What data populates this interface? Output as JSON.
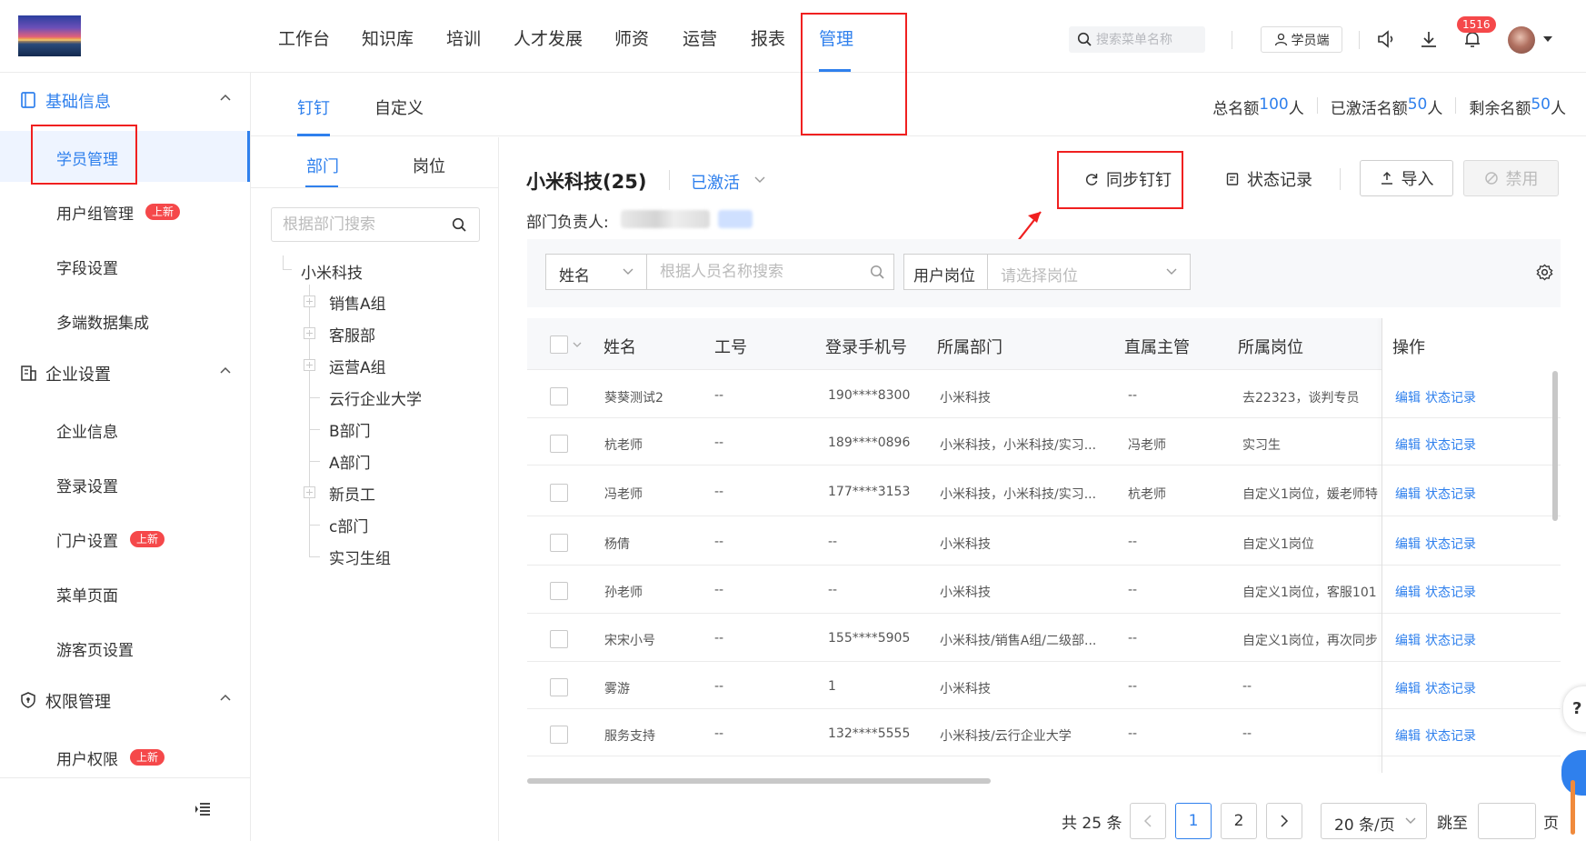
{
  "header": {
    "nav": [
      "工作台",
      "知识库",
      "培训",
      "人才发展",
      "师资",
      "运营",
      "报表",
      "管理"
    ],
    "active_nav": "管理",
    "search_placeholder": "搜索菜单名称",
    "student_btn": "学员端",
    "notification_count": "1516"
  },
  "sidebar": {
    "groups": [
      {
        "label": "基础信息",
        "icon": "book-icon",
        "items": [
          {
            "label": "学员管理",
            "active": true
          },
          {
            "label": "用户组管理",
            "badge": "上新"
          },
          {
            "label": "字段设置"
          },
          {
            "label": "多端数据集成"
          }
        ]
      },
      {
        "label": "企业设置",
        "icon": "building-icon",
        "items": [
          {
            "label": "企业信息"
          },
          {
            "label": "登录设置"
          },
          {
            "label": "门户设置",
            "badge": "上新"
          },
          {
            "label": "菜单页面"
          },
          {
            "label": "游客页设置"
          }
        ]
      },
      {
        "label": "权限管理",
        "icon": "shield-icon",
        "items": [
          {
            "label": "用户权限",
            "badge": "上新"
          }
        ]
      }
    ]
  },
  "tabs": [
    "钉钉",
    "自定义"
  ],
  "quota": {
    "total_label": "总名额",
    "total": "100",
    "total_unit": "人",
    "active_label": "已激活名额",
    "active": "50",
    "active_unit": "人",
    "remain_label": "剩余名额",
    "remain": "50",
    "remain_unit": "人"
  },
  "tree": {
    "subtabs": [
      "部门",
      "岗位"
    ],
    "search_placeholder": "根据部门搜索",
    "root": "小米科技",
    "nodes": [
      {
        "label": "销售A组",
        "expandable": true
      },
      {
        "label": "客服部",
        "expandable": true
      },
      {
        "label": "运营A组",
        "expandable": true
      },
      {
        "label": "云行企业大学",
        "expandable": false
      },
      {
        "label": "B部门",
        "expandable": false
      },
      {
        "label": "A部门",
        "expandable": false
      },
      {
        "label": "新员工",
        "expandable": true
      },
      {
        "label": "c部门",
        "expandable": false
      },
      {
        "label": "实习生组",
        "expandable": false
      }
    ]
  },
  "main": {
    "company": "小米科技(25)",
    "status": "已激活",
    "dept_head_label": "部门负责人:",
    "buttons": {
      "sync": "同步钉钉",
      "status_log": "状态记录",
      "import": "导入",
      "disable": "禁用"
    },
    "filter": {
      "field_select": "姓名",
      "name_placeholder": "根据人员名称搜索",
      "post_label": "用户岗位",
      "post_placeholder": "请选择岗位"
    },
    "columns": [
      "姓名",
      "工号",
      "登录手机号",
      "所属部门",
      "直属主管",
      "所属岗位",
      "操作"
    ],
    "rows": [
      {
        "name": "葵葵测试2",
        "no": "--",
        "phone": "190****8300",
        "dept": "小米科技",
        "mgr": "--",
        "post": "去22323，谈判专员"
      },
      {
        "name": "杭老师",
        "no": "--",
        "phone": "189****0896",
        "dept": "小米科技，小米科技/实习...",
        "mgr": "冯老师",
        "post": "实习生"
      },
      {
        "name": "冯老师",
        "no": "--",
        "phone": "177****3153",
        "dept": "小米科技，小米科技/实习...",
        "mgr": "杭老师",
        "post": "自定义1岗位，媛老师特"
      },
      {
        "name": "杨倩",
        "no": "--",
        "phone": "--",
        "dept": "小米科技",
        "mgr": "--",
        "post": "自定义1岗位"
      },
      {
        "name": "孙老师",
        "no": "--",
        "phone": "--",
        "dept": "小米科技",
        "mgr": "--",
        "post": "自定义1岗位，客服101"
      },
      {
        "name": "宋宋小号",
        "no": "--",
        "phone": "155****5905",
        "dept": "小米科技/销售A组/二级部...",
        "mgr": "--",
        "post": "自定义1岗位，再次同步"
      },
      {
        "name": "雾游",
        "no": "--",
        "phone": "1",
        "dept": "小米科技",
        "mgr": "--",
        "post": "--"
      },
      {
        "name": "服务支持",
        "no": "--",
        "phone": "132****5555",
        "dept": "小米科技/云行企业大学",
        "mgr": "--",
        "post": "--"
      }
    ],
    "op_edit": "编辑",
    "op_log": "状态记录"
  },
  "pagination": {
    "total": "共 25 条",
    "pages": [
      "1",
      "2"
    ],
    "current": "1",
    "page_size": "20 条/页",
    "jump_label": "跳至",
    "page_label": "页"
  },
  "colors": {
    "accent": "#2f80ed",
    "badge": "#f5484a",
    "highlight": "#f02020"
  }
}
